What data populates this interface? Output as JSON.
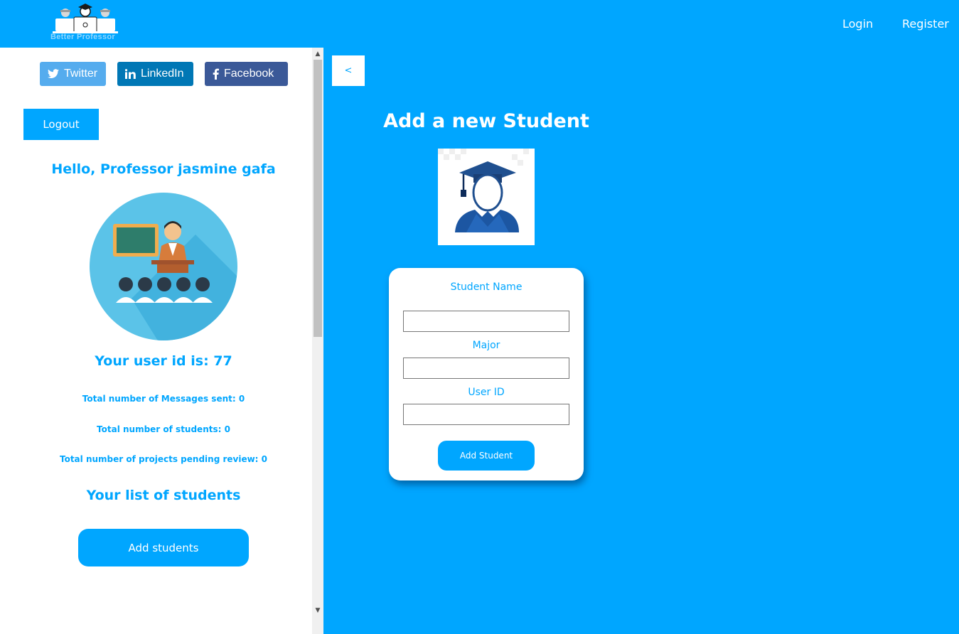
{
  "header": {
    "logo_text": "Better Professor",
    "nav": {
      "login": "Login",
      "register": "Register"
    }
  },
  "sidebar": {
    "social": {
      "twitter": "Twitter",
      "linkedin": "LinkedIn",
      "facebook": "Facebook"
    },
    "logout_label": "Logout",
    "greeting": "Hello, Professor jasmine gafa",
    "user_id_text": "Your user id is: 77",
    "stats": {
      "messages": "Total number of Messages sent: 0",
      "students": "Total number of students: 0",
      "projects": "Total number of projects pending review: 0"
    },
    "list_title": "Your list of students",
    "add_students_label": "Add students"
  },
  "main": {
    "back_label": "<",
    "title": "Add a new Student",
    "form": {
      "name_label": "Student Name",
      "major_label": "Major",
      "userid_label": "User ID",
      "name_value": "",
      "major_value": "",
      "userid_value": "",
      "submit_label": "Add Student"
    }
  },
  "colors": {
    "accent": "#00a6ff",
    "twitter": "#55acee",
    "linkedin": "#0077b5",
    "facebook": "#3b5998"
  }
}
